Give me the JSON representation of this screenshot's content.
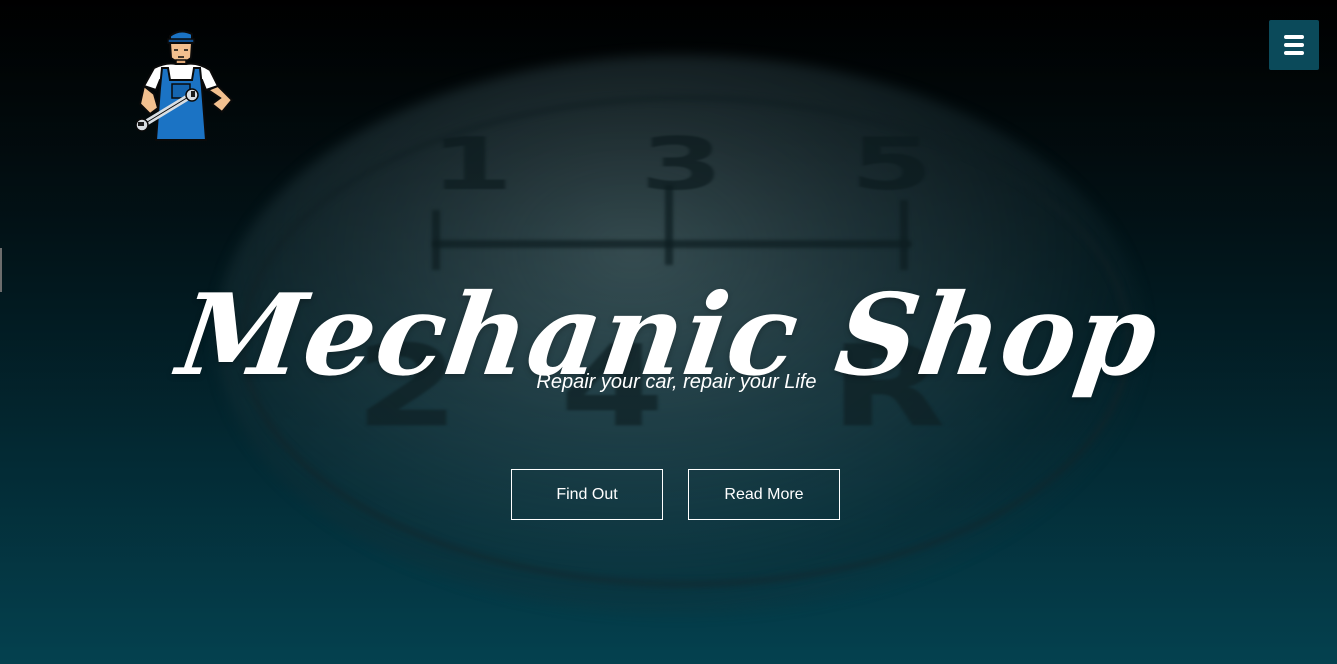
{
  "header": {
    "logo_icon": "mechanic-with-wrench-logo",
    "menu_icon": "hamburger-menu-icon",
    "accent_color": "#0b4a5a"
  },
  "hero": {
    "title": "Mechanic Shop",
    "tagline": "Repair your car, repair your Life",
    "background": "blurred gear shift knob"
  },
  "buttons": {
    "find_out": "Find Out",
    "read_more": "Read More"
  }
}
